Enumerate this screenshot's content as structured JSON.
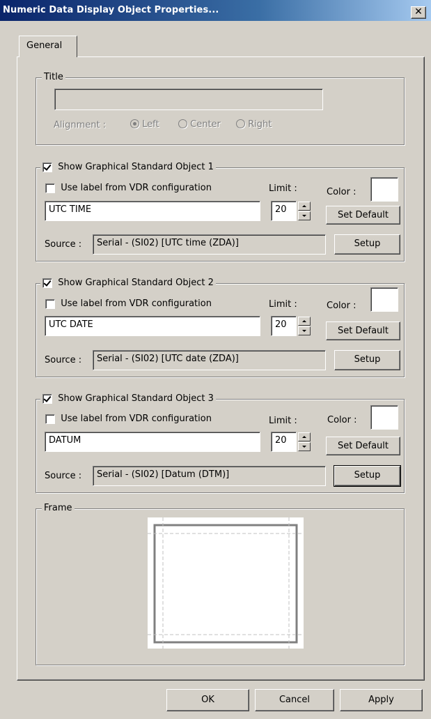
{
  "window": {
    "title": "Numeric Data Display Object Properties...",
    "close_glyph": "✕"
  },
  "tabs": [
    {
      "label": "General",
      "selected": true
    }
  ],
  "title_group": {
    "legend": "Title",
    "value": "",
    "alignment_label": "Alignment :",
    "options": [
      "Left",
      "Center",
      "Right"
    ],
    "selected": "Left",
    "enabled": false
  },
  "objects": [
    {
      "legend": "Show Graphical Standard Object 1",
      "checked": true,
      "use_label_text": "Use label from VDR configuration",
      "use_label_checked": false,
      "limit_label": "Limit :",
      "color_label": "Color :",
      "color": "#ffffff",
      "label_value": "UTC TIME",
      "limit_value": "20",
      "set_default_label": "Set Default",
      "source_label": "Source :",
      "source_value": "Serial - (SI02)  [UTC time (ZDA)]",
      "setup_label": "Setup"
    },
    {
      "legend": "Show Graphical Standard Object 2",
      "checked": true,
      "use_label_text": "Use label from VDR configuration",
      "use_label_checked": false,
      "limit_label": "Limit :",
      "color_label": "Color :",
      "color": "#ffffff",
      "label_value": "UTC DATE",
      "limit_value": "20",
      "set_default_label": "Set Default",
      "source_label": "Source :",
      "source_value": "Serial - (SI02)  [UTC date (ZDA)]",
      "setup_label": "Setup"
    },
    {
      "legend": "Show Graphical Standard Object 3",
      "checked": true,
      "use_label_text": "Use label from VDR configuration",
      "use_label_checked": false,
      "limit_label": "Limit :",
      "color_label": "Color :",
      "color": "#ffffff",
      "label_value": "DATUM",
      "limit_value": "20",
      "set_default_label": "Set Default",
      "source_label": "Source :",
      "source_value": "Serial - (SI02)  [Datum (DTM)]",
      "setup_label": "Setup"
    }
  ],
  "frame_group": {
    "legend": "Frame"
  },
  "buttons": {
    "ok": "OK",
    "cancel": "Cancel",
    "apply": "Apply"
  },
  "colors": {
    "face": "#d4d0c8",
    "titlebar_start": "#0a246a",
    "titlebar_end": "#a6caf0",
    "frame_line": "#808080"
  }
}
